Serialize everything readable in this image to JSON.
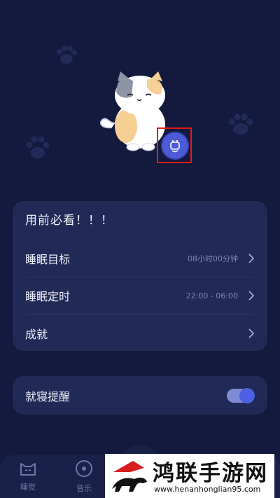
{
  "card": {
    "title": "用前必看！！！",
    "items": [
      {
        "label": "睡眠目标",
        "value": "08小时00分钟"
      },
      {
        "label": "睡眠定时",
        "value": "22:00 - 06:00"
      },
      {
        "label": "成就",
        "value": ""
      }
    ]
  },
  "bedtime_reminder": {
    "label": "就寝提醒",
    "enabled": true
  },
  "nav": {
    "items": [
      {
        "label": "睡觉"
      },
      {
        "label": "音乐"
      }
    ]
  },
  "watermark": {
    "title": "鸿联手游网",
    "url": "www.henanhonglian95.com"
  },
  "colors": {
    "background": "#141a3d",
    "card": "#212a56",
    "accent": "#4f5fe2",
    "highlight": "#e11b1b"
  }
}
